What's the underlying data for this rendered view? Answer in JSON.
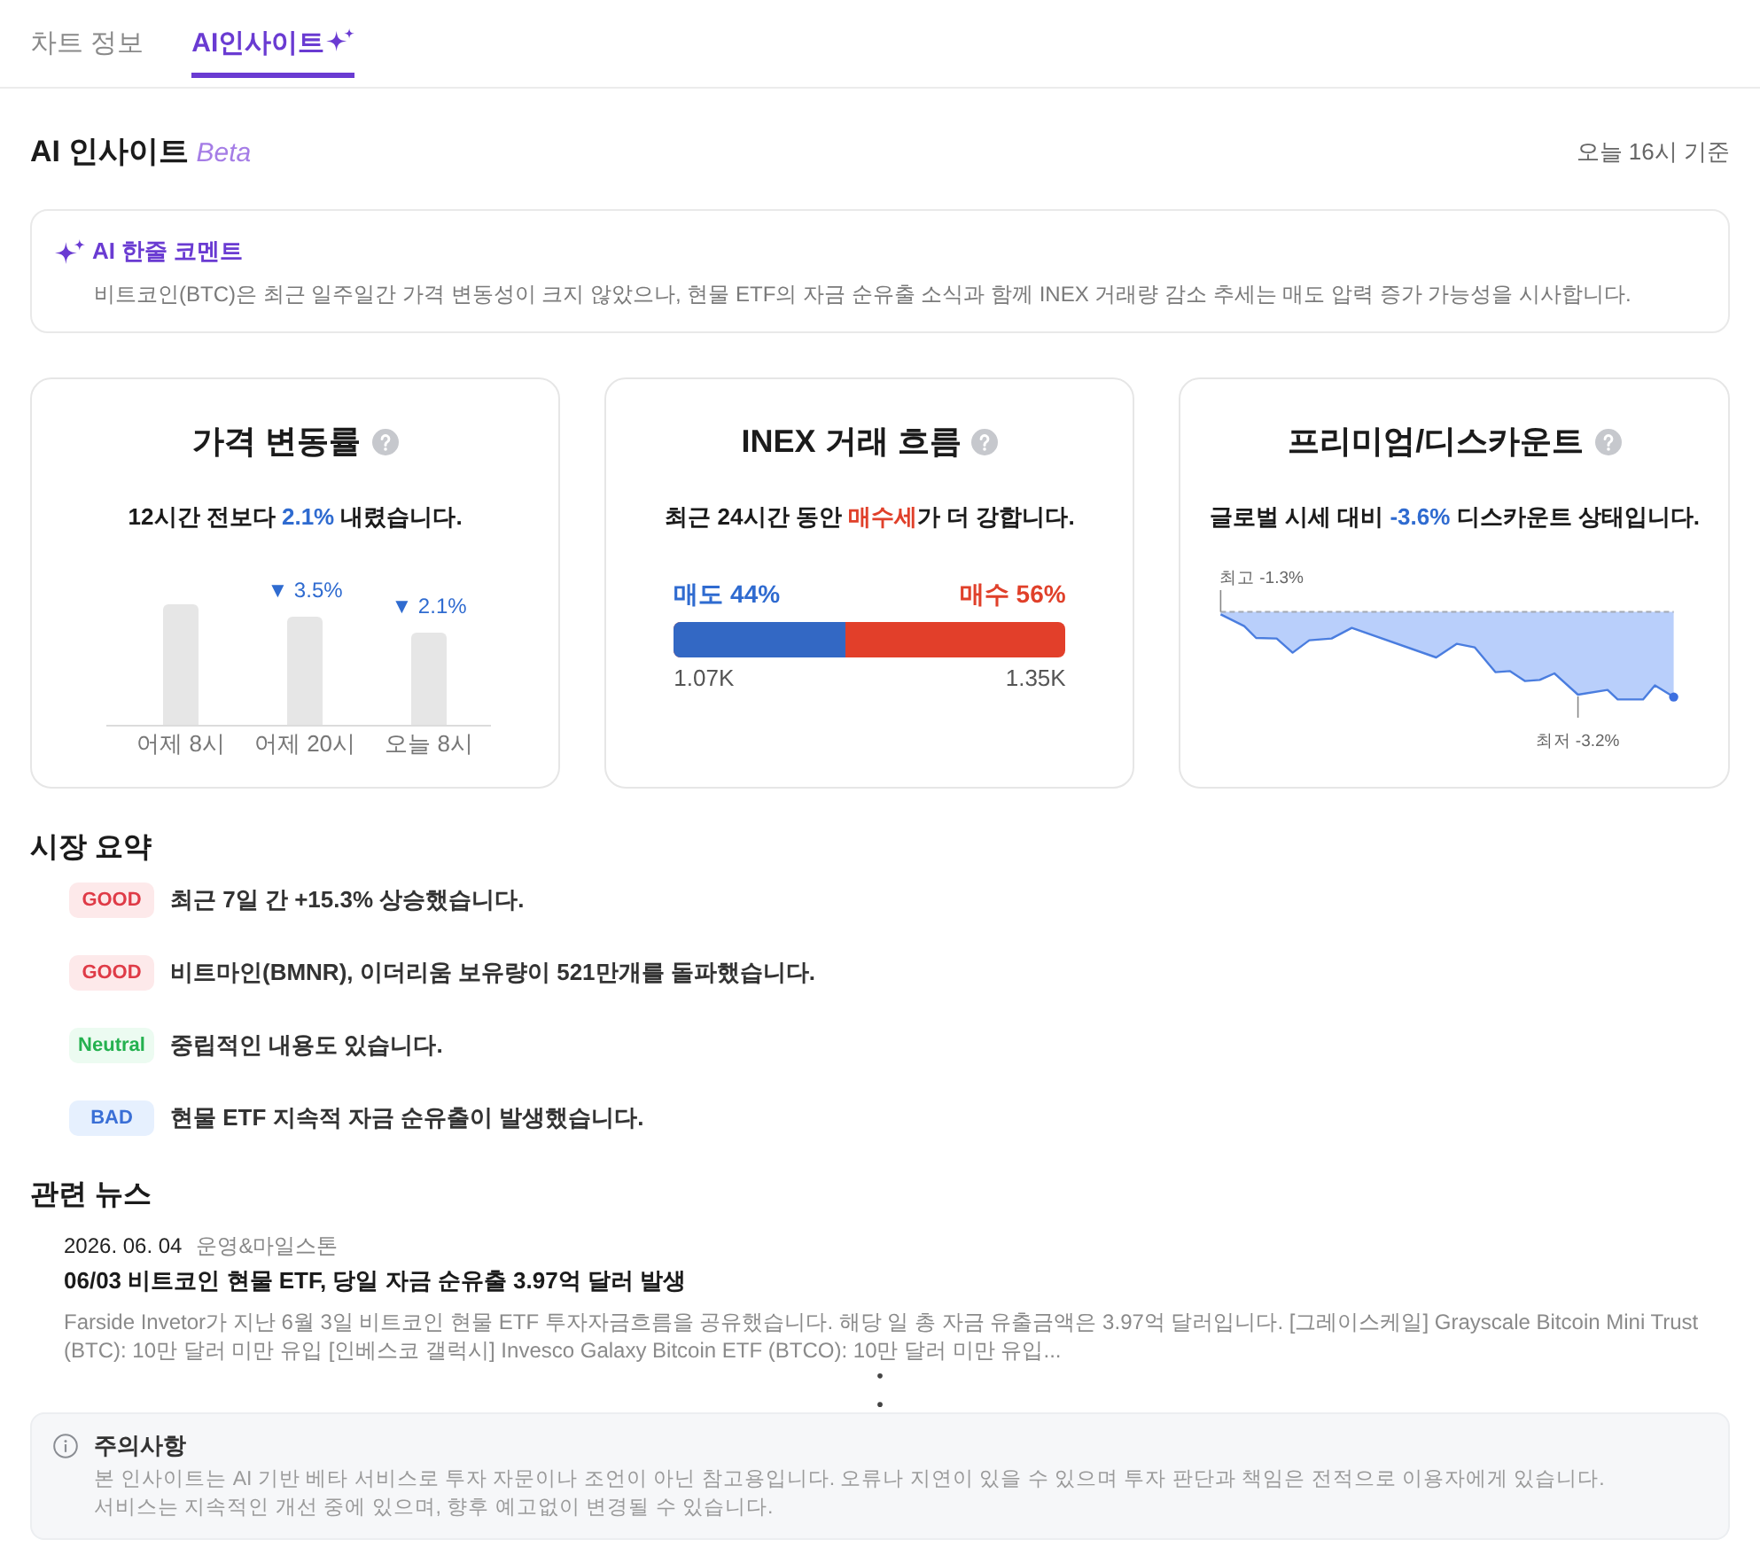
{
  "tabs": [
    {
      "label": "차트 정보",
      "selected": false,
      "kind": "plain"
    },
    {
      "label": "AI인사이트",
      "selected": true,
      "kind": "ai"
    }
  ],
  "header": {
    "title": "AI 인사이트",
    "tag": "Beta",
    "updated": "오늘 16시 기준"
  },
  "ai_comment": {
    "title": "AI 한줄 코멘트",
    "text": "비트코인(BTC)은 최근 일주일간 가격 변동성이 크지 않았으나, 현물 ETF의 자금 순유출 소식과 함께 INEX 거래량 감소 추세는 매도 압력 증가 가능성을 시사합니다."
  },
  "cards": [
    {
      "kind": "bars",
      "title": "가격 변동률",
      "summary": [
        {
          "text": "12시간 전보다 "
        },
        {
          "text": "2.1%",
          "color": "#2f6bd0"
        },
        {
          "text": " 내렸습니다."
        }
      ],
      "bars": [
        {
          "label": "어제 8시"
        },
        {
          "label": "어제 20시",
          "change": "▼ 3.5%"
        },
        {
          "label": "오늘 8시",
          "change": "▼ 2.1%"
        }
      ]
    },
    {
      "kind": "split",
      "title": "INEX 거래 흐름",
      "summary": [
        {
          "text": "최근 24시간 동안 "
        },
        {
          "text": "매수세",
          "color": "#e0402a"
        },
        {
          "text": "가 더 강합니다."
        }
      ],
      "sell": {
        "label": "매도 44%",
        "level": 0.44,
        "amount": "1.07K"
      },
      "buy": {
        "label": "매수 56%",
        "amount": "1.35K"
      }
    },
    {
      "kind": "area",
      "title": "프리미엄/디스카운트",
      "summary": [
        {
          "text": "글로벌 시세 대비 "
        },
        {
          "text": "-3.6%",
          "color": "#2f6bd0"
        },
        {
          "text": " 디스카운트 상태입니다."
        }
      ],
      "high_label": "최고 -1.3%",
      "low_label": "최저 -3.2%"
    }
  ],
  "market_summary": {
    "title": "시장 요약",
    "items": [
      {
        "kind": "good",
        "badge": "GOOD",
        "text": "최근 7일 간 +15.3% 상승했습니다."
      },
      {
        "kind": "good",
        "badge": "GOOD",
        "text": "비트마인(BMNR), 이더리움 보유량이 521만개를 돌파했습니다."
      },
      {
        "kind": "neutral",
        "badge": "Neutral",
        "text": "중립적인 내용도 있습니다."
      },
      {
        "kind": "bad",
        "badge": "BAD",
        "text": "현물 ETF 지속적 자금 순유출이 발생했습니다."
      }
    ]
  },
  "news": {
    "title": "관련 뉴스",
    "items": [
      {
        "date": "2026. 06. 04",
        "category": "운영&마일스톤",
        "title": "06/03 비트코인 현물 ETF, 당일 자금 순유출 3.97억 달러 발생",
        "summary": "Farside Invetor가 지난 6월 3일 비트코인 현물 ETF 투자자금흐름을 공유했습니다. 해당 일 총 자금 유출금액은 3.97억 달러입니다. [그레이스케일] Grayscale Bitcoin Mini Trust (BTC): 10만 달러 미만 유입 [인베스코 갤럭시] Invesco Galaxy Bitcoin ETF (BTCO): 10만 달러 미만 유입..."
      }
    ]
  },
  "notice": {
    "title": "주의사항",
    "lines": [
      "본 인사이트는 AI 기반 베타 서비스로 투자 자문이나 조언이 아닌 참고용입니다. 오류나 지연이 있을 수 있으며 투자 판단과 책임은 전적으로 이용자에게 있습니다.",
      "서비스는 지속적인 개선 중에 있으며, 향후 예고없이 변경될 수 있습니다."
    ]
  }
}
